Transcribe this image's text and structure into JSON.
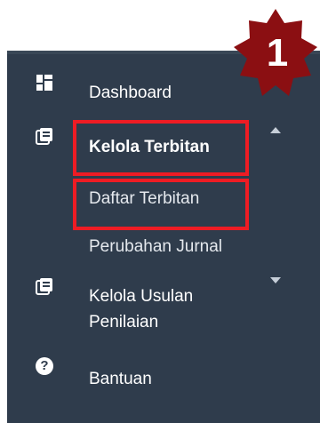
{
  "sidebar": {
    "items": [
      {
        "label": "Dashboard",
        "icon": "dashboard-icon"
      },
      {
        "label": "Kelola Terbitan",
        "icon": "publication-icon",
        "expanded": true
      },
      {
        "label": "Daftar Terbitan"
      },
      {
        "label": "Perubahan Jurnal"
      },
      {
        "label": "Kelola Usulan Penilaian",
        "icon": "publication-icon",
        "expanded": false
      },
      {
        "label": "Bantuan",
        "icon": "help-icon",
        "icon_glyph": "?"
      }
    ]
  },
  "annotation": {
    "step_number": "1",
    "badge_color": "#8b0f12",
    "highlight_color": "#ee1c24"
  },
  "colors": {
    "sidebar_bg": "#2f3c4c",
    "text": "#ffffff"
  }
}
